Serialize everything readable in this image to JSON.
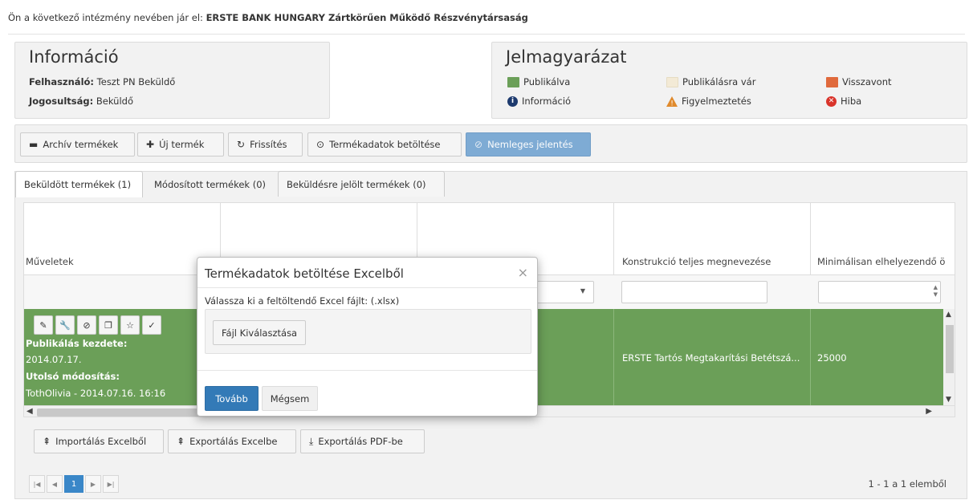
{
  "topbar": {
    "prefix": "Ön a következő intézmény nevében jár el:",
    "institution": "ERSTE BANK HUNGARY Zártkörűen Működő Részvénytársaság"
  },
  "info": {
    "title": "Információ",
    "user_label": "Felhasználó:",
    "user_value": "Teszt PN Beküldő",
    "role_label": "Jogosultság:",
    "role_value": "Beküldő"
  },
  "legend": {
    "title": "Jelmagyarázat",
    "items": [
      {
        "label": "Publikálva",
        "color": "#6b9f58",
        "icon": "green-square"
      },
      {
        "label": "Publikálásra vár",
        "color": "#f3ead6",
        "icon": "beige-square"
      },
      {
        "label": "Visszavont",
        "color": "#e06a3c",
        "icon": "orange-square"
      },
      {
        "label": "Információ",
        "color": "#1d3a6e",
        "icon": "info-icon"
      },
      {
        "label": "Figyelmeztetés",
        "color": "#e08a2c",
        "icon": "warning-icon"
      },
      {
        "label": "Hiba",
        "color": "#d9342b",
        "icon": "error-icon"
      }
    ]
  },
  "toolbar": {
    "archive": "Archív termékek",
    "new_product": "Új termék",
    "refresh": "Frissítés",
    "load_data": "Termékadatok betöltése",
    "negative_report": "Nemleges jelentés"
  },
  "tabs": [
    {
      "label": "Beküldött termékek (1)"
    },
    {
      "label": "Módosított termékek (0)"
    },
    {
      "label": "Beküldésre jelölt termékek (0)"
    }
  ],
  "grid": {
    "headers": [
      "Műveletek",
      "",
      "",
      "Konstrukció teljes megnevezése",
      "Minimálisan elhelyezendő ö"
    ],
    "row": {
      "pub_start_label": "Publikálás kezdete:",
      "pub_start_value": "2014.07.17.",
      "last_mod_label": "Utolsó módosítás:",
      "last_mod_value": "TothOlivia - 2014.07.16. 16:16",
      "construction": "ERSTE Tartós Megtakarítási Betétszá...",
      "min_amount": "25000"
    }
  },
  "export": {
    "import_excel": "Importálás Excelből",
    "export_excel": "Exportálás Excelbe",
    "export_pdf": "Exportálás PDF-be"
  },
  "pager": {
    "current": "1",
    "info": "1 - 1 a 1 elemből"
  },
  "modal": {
    "title": "Termékadatok betöltése Excelből",
    "close": "×",
    "label": "Válassza ki a feltöltendő Excel fájlt: (.xlsx)",
    "choose_file": "Fájl Kiválasztása",
    "next": "Tovább",
    "cancel": "Mégsem"
  }
}
